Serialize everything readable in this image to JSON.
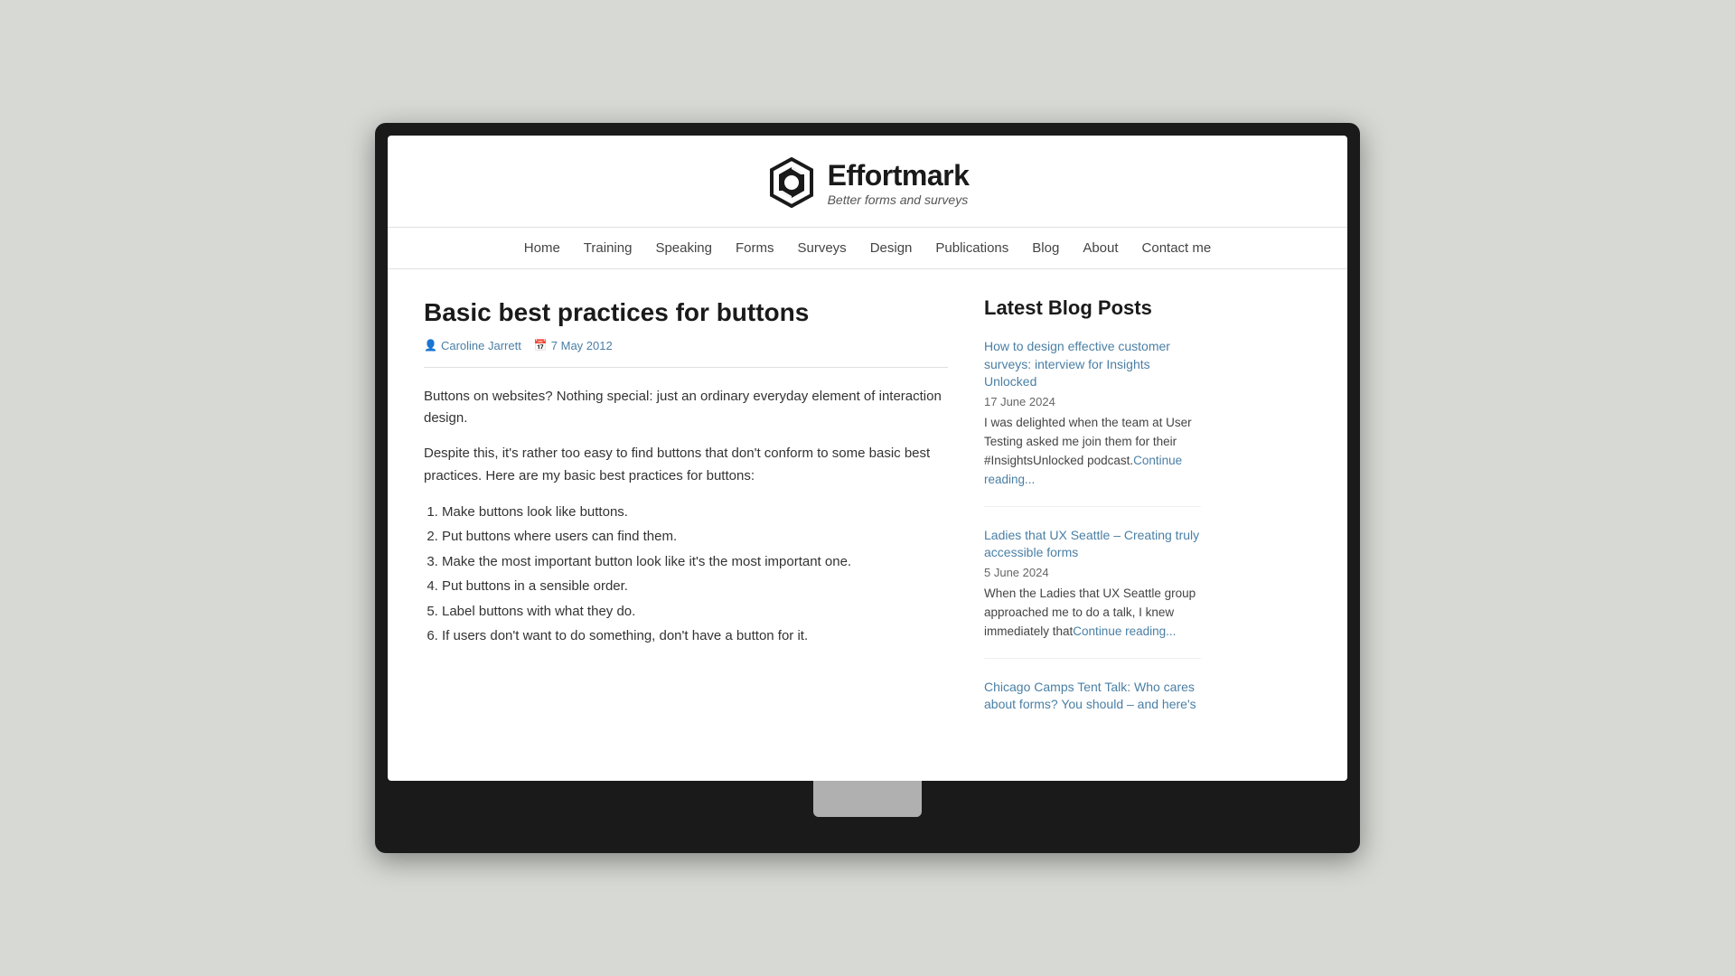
{
  "site": {
    "logo_name": "Effortmark",
    "logo_tagline": "Better forms and surveys"
  },
  "nav": {
    "items": [
      {
        "label": "Home",
        "href": "#"
      },
      {
        "label": "Training",
        "href": "#"
      },
      {
        "label": "Speaking",
        "href": "#"
      },
      {
        "label": "Forms",
        "href": "#"
      },
      {
        "label": "Surveys",
        "href": "#"
      },
      {
        "label": "Design",
        "href": "#"
      },
      {
        "label": "Publications",
        "href": "#"
      },
      {
        "label": "Blog",
        "href": "#"
      },
      {
        "label": "About",
        "href": "#"
      },
      {
        "label": "Contact me",
        "href": "#"
      }
    ]
  },
  "article": {
    "title": "Basic best practices for buttons",
    "author": "Caroline Jarrett",
    "date": "7 May 2012",
    "intro1": "Buttons on websites? Nothing special: just an ordinary everyday element of interaction design.",
    "intro2": "Despite this, it's rather too easy to find buttons that don't conform to some basic best practices. Here are my basic best practices for buttons:",
    "list_items": [
      "Make buttons look like buttons.",
      "Put buttons where users can find them.",
      "Make the most important button look like it's the most important one.",
      "Put buttons in a sensible order.",
      "Label buttons with what they do.",
      "If users don't want to do something, don't have a button for it."
    ]
  },
  "sidebar": {
    "title": "Latest Blog Posts",
    "posts": [
      {
        "title": "How to design effective customer surveys: interview for Insights Unlocked",
        "date": "17 June 2024",
        "excerpt": "I was delighted when the team at User Testing asked me join them for their #InsightsUnlocked podcast.",
        "continue_label": "Continue reading..."
      },
      {
        "title": "Ladies that UX Seattle – Creating truly accessible forms",
        "date": "5 June 2024",
        "excerpt": "When the Ladies that UX Seattle group approached me to do a talk, I knew immediately that",
        "continue_label": "Continue reading..."
      },
      {
        "title": "Chicago Camps Tent Talk: Who cares about forms? You should – and here's",
        "date": "",
        "excerpt": "",
        "continue_label": ""
      }
    ]
  },
  "icons": {
    "author_icon": "👤",
    "calendar_icon": "📅"
  }
}
